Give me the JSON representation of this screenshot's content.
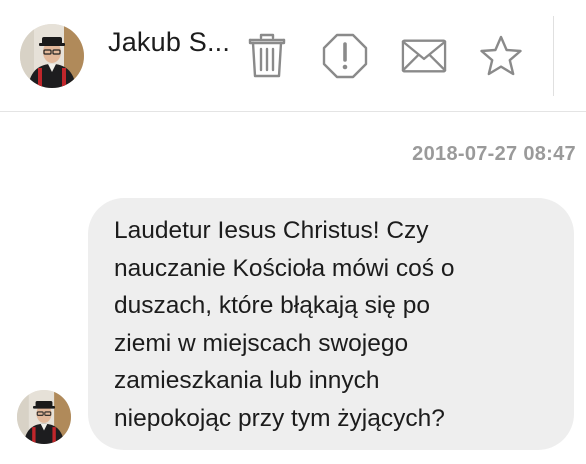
{
  "header": {
    "contact_name": "Jakub S...",
    "avatar_icon": "user-avatar-photo",
    "actions": [
      {
        "name": "delete",
        "icon": "trash-icon"
      },
      {
        "name": "report",
        "icon": "alert-octagon-icon"
      },
      {
        "name": "mail",
        "icon": "envelope-icon"
      },
      {
        "name": "favorite",
        "icon": "star-icon"
      }
    ]
  },
  "conversation": {
    "timestamp": "2018-07-27 08:47",
    "message": {
      "lines": [
        "Laudetur Iesus Christus! Czy",
        "nauczanie Kościoła mówi coś o",
        "duszach, które błąkają się po",
        "ziemi w miejscach swojego",
        "zamieszkania lub innych",
        "niepokojąc przy tym żyjących?"
      ]
    }
  },
  "colors": {
    "bubble_bg": "#eeeeee",
    "icon_gray": "#8a8a8a",
    "timestamp_gray": "#9a9a9a",
    "text": "#1c1c1c",
    "divider": "#e4e4e4"
  }
}
